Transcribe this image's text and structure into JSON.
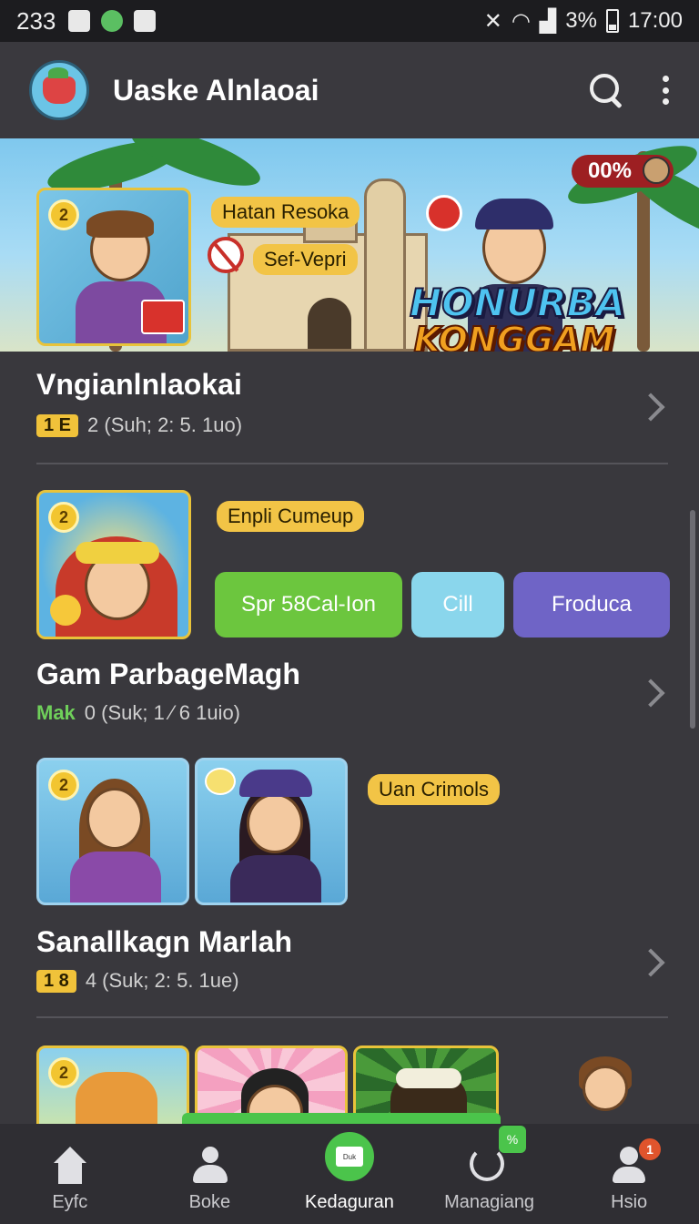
{
  "status_bar": {
    "time_left": "233",
    "battery": "3%",
    "clock": "17:00"
  },
  "app_bar": {
    "title": "Uaske Alnlaoai"
  },
  "banner": {
    "card_badge": "2",
    "pill_1": "Hatan Resoka",
    "pill_2": "Sef-Vepri",
    "percent_tag": "00%",
    "logo_line_1": "HONURBA",
    "logo_line_2": "KONGGAM"
  },
  "items": [
    {
      "title": "Vngianlnlaokai",
      "tag": "1 E",
      "meta": "2 (Suh; 2: 5. 1uo)"
    },
    {
      "title": "Gam ParbageMagh",
      "tag": "Mak",
      "meta": "0 (Suk; 1 ⁄ 6 1uio)",
      "card_badge": "2",
      "pill": "Enpli Cumeup",
      "buttons": [
        {
          "label": "Spr 58Cal-Ion",
          "color": "#6cc63e"
        },
        {
          "label": "Cill",
          "color": "#8ad6ec"
        },
        {
          "label": "Froduca",
          "color": "#6f64c6"
        }
      ]
    },
    {
      "title": "Sanallkagn Marlah",
      "tag": "1 8",
      "meta": "4 (Suk; 2: 5. 1ue)",
      "card_badge": "2",
      "pill": "Uan Crimols"
    },
    {
      "card_badge": "2"
    }
  ],
  "bottom_nav": [
    {
      "label": "Eyfc",
      "icon": "home-icon"
    },
    {
      "label": "Boke",
      "icon": "people-icon"
    },
    {
      "label": "Kedaguran",
      "icon": "wallet-icon",
      "card_text": "Duk"
    },
    {
      "label": "Managiang",
      "icon": "manage-icon",
      "badge": "%"
    },
    {
      "label": "Hsio",
      "icon": "profile-icon",
      "badge": "1"
    }
  ],
  "colors": {
    "background": "#39383d",
    "accent_yellow": "#f0c23a",
    "accent_green": "#4bc44b"
  }
}
